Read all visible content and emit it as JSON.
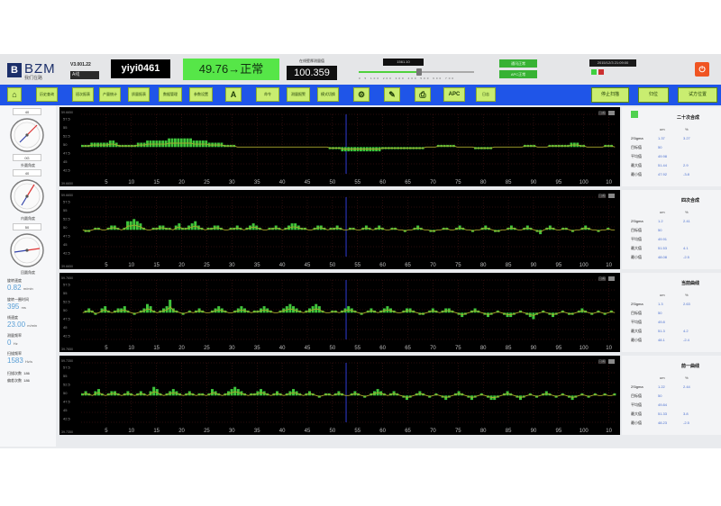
{
  "header": {
    "logo": "BZM",
    "logo_sub": "我们在路",
    "version": "V3.001.22",
    "selector": "A线",
    "user_id": "yiyi0461",
    "status": "49.76→正常",
    "value_caption": "在线壁厚测量值",
    "value": "100.359",
    "range_box": "1561.10",
    "slider_scale": "0 5 100 200 300 400 500 600 700",
    "status_btn_1": "通讯正常",
    "status_btn_2": "APC正常",
    "datetime": "2015/12/3 21:09:00",
    "slider_percent": 52
  },
  "toolbar": {
    "buttons": [
      "历史查询",
      "班次报表",
      "产量统计",
      "质量报表",
      "数据管理",
      "参数设置",
      "A",
      "命令",
      "测量报警",
      "模式切换",
      "⚙",
      "✎",
      "⎙",
      "APC",
      "日志"
    ],
    "stop_scan": "停止扫描",
    "reset": "归位",
    "settings": "试方位置"
  },
  "left_panel": {
    "g1_top": "40",
    "g1_bottom": "0G",
    "g1_label": "外圆角度",
    "g2_top": "40",
    "g2_label": "内圆角度",
    "g3_top": "50",
    "g3_label": "回圆角度",
    "r1_label": "旋转速度",
    "r1_val": "0.82",
    "r1_unit": "m/min",
    "r2_label": "旋转一圈时间",
    "r2_val": "395",
    "r2_unit": "ms",
    "r3_label": "线速度",
    "r3_val": "23.00",
    "r3_unit": "m/min",
    "r4_label": "测量频率",
    "r4_val": "0",
    "r4_unit": "Hz",
    "r5_label": "扫描频率",
    "r5_val": "1583",
    "r5_unit": "Hz/s",
    "r6_label": "扫描次数",
    "r6_val": "186",
    "r7_label": "偏差次数",
    "r7_val": "186"
  },
  "charts": {
    "ticks": [
      "5",
      "10",
      "15",
      "20",
      "25",
      "30",
      "35",
      "40",
      "45",
      "50",
      "55",
      "60",
      "65",
      "70",
      "75",
      "80",
      "85",
      "90",
      "95",
      "100",
      "10"
    ],
    "btn_label": "回图",
    "c1": {
      "title": "二十次合成",
      "y_top": "59.6650",
      "y_bot": "39.6650",
      "ytick": [
        "57.5",
        "55",
        "52.5",
        "50",
        "47.5",
        "45",
        "42.5"
      ],
      "bars": [
        1,
        1,
        1,
        2,
        2,
        2,
        2,
        2,
        2,
        3,
        3,
        2,
        1,
        1,
        1,
        1,
        1,
        1,
        2,
        2,
        2,
        3,
        3,
        3,
        3,
        3,
        3,
        3,
        4,
        4,
        4,
        4,
        4,
        4,
        4,
        4,
        3,
        3,
        3,
        3,
        3,
        2,
        2,
        2,
        2,
        2,
        1,
        1,
        1,
        1,
        0,
        0,
        0,
        0,
        0,
        0,
        0,
        0,
        0,
        0,
        0,
        0,
        0,
        0,
        0,
        0,
        0,
        0,
        0,
        0,
        0,
        0,
        0,
        0,
        0,
        0,
        0,
        0,
        0,
        0,
        -1,
        -1,
        -1,
        -1,
        -2,
        -2,
        -2,
        -2,
        -2,
        -2,
        -2,
        -2,
        -2,
        -2,
        -2,
        -2,
        -2,
        -1,
        -1,
        -1,
        -1,
        -1,
        -1,
        -1,
        -1,
        -1,
        -1,
        -1,
        -1,
        -1,
        -1,
        0,
        0,
        0,
        0,
        1,
        1,
        1,
        1,
        1,
        1,
        0,
        0,
        0,
        0,
        0,
        0,
        -1,
        -1,
        -1,
        -1,
        -1,
        -1,
        0,
        0,
        0,
        0,
        0,
        0,
        0,
        0,
        0,
        0,
        1,
        1,
        1,
        1,
        0,
        0,
        0,
        0,
        1,
        1,
        1,
        1,
        1,
        1,
        1,
        2,
        2,
        2,
        1,
        1,
        0,
        0,
        0,
        0,
        0,
        0,
        1,
        1,
        1,
        0
      ]
    },
    "c2": {
      "title": "四次合成",
      "y_top": "59.6650",
      "y_bot": "39.6650",
      "ytick": [
        "57.5",
        "55",
        "52.5",
        "50",
        "47.5",
        "45",
        "42.5"
      ],
      "bars": [
        0,
        -1,
        -1,
        0,
        1,
        1,
        0,
        0,
        1,
        2,
        2,
        1,
        0,
        1,
        4,
        4,
        5,
        4,
        3,
        1,
        0,
        0,
        1,
        1,
        2,
        2,
        1,
        1,
        0,
        2,
        3,
        1,
        1,
        2,
        3,
        4,
        2,
        1,
        0,
        1,
        1,
        2,
        2,
        1,
        0,
        0,
        1,
        1,
        2,
        1,
        0,
        1,
        2,
        3,
        2,
        1,
        0,
        0,
        1,
        1,
        2,
        1,
        0,
        1,
        2,
        3,
        3,
        2,
        1,
        1,
        0,
        0,
        1,
        2,
        2,
        1,
        0,
        1,
        1,
        2,
        1,
        0,
        0,
        1,
        1,
        0,
        0,
        1,
        2,
        1,
        0,
        1,
        2,
        1,
        0,
        0,
        1,
        1,
        0,
        0,
        -1,
        0,
        0,
        1,
        2,
        1,
        0,
        0,
        -1,
        -1,
        0,
        0,
        1,
        1,
        0,
        0,
        1,
        2,
        1,
        0,
        0,
        -1,
        0,
        0,
        1,
        2,
        1,
        0,
        -1,
        -1,
        0,
        0,
        1,
        2,
        1,
        0,
        0,
        1,
        2,
        1,
        0,
        -1,
        -2,
        0,
        1,
        2,
        1,
        0,
        0,
        1,
        1,
        0,
        -1,
        0,
        0,
        1,
        2,
        1,
        0,
        0,
        -1,
        0,
        0,
        1,
        0,
        0
      ]
    },
    "c3": {
      "title": "当前曲线",
      "y_top": "59.7650",
      "y_bot": "39.7650",
      "ytick": [
        "57.5",
        "55",
        "52.5",
        "50",
        "47.5",
        "45",
        "42.5"
      ],
      "bars": [
        0,
        1,
        2,
        1,
        -1,
        0,
        2,
        3,
        1,
        0,
        1,
        2,
        2,
        3,
        1,
        0,
        -1,
        0,
        1,
        2,
        4,
        3,
        1,
        0,
        1,
        2,
        3,
        6,
        2,
        1,
        0,
        -1,
        0,
        1,
        0,
        1,
        2,
        1,
        0,
        0,
        1,
        2,
        3,
        2,
        1,
        0,
        0,
        1,
        2,
        3,
        2,
        1,
        0,
        1,
        1,
        2,
        3,
        2,
        1,
        0,
        0,
        1,
        2,
        3,
        4,
        3,
        2,
        1,
        0,
        1,
        2,
        3,
        4,
        3,
        1,
        0,
        0,
        1,
        1,
        0,
        1,
        2,
        3,
        2,
        1,
        0,
        -1,
        0,
        1,
        2,
        1,
        0,
        1,
        2,
        3,
        2,
        1,
        0,
        0,
        1,
        2,
        2,
        1,
        0,
        -1,
        -1,
        0,
        1,
        2,
        1,
        0,
        1,
        2,
        2,
        1,
        0,
        -1,
        -2,
        -1,
        0,
        1,
        2,
        1,
        0,
        -1,
        -2,
        -1,
        0,
        1,
        0,
        -1,
        -2,
        -2,
        -1,
        0,
        1,
        0,
        -1,
        -2,
        -3,
        -1,
        0,
        1,
        0,
        -1,
        -2,
        -1,
        0,
        1,
        0,
        -1,
        -1,
        0,
        1,
        2,
        1,
        0,
        -1,
        0,
        1,
        0,
        -1,
        0,
        1,
        0
      ]
    },
    "c4": {
      "title": "前一曲线",
      "y_top": "59.7350",
      "y_bot": "39.7350",
      "ytick": [
        "57.5",
        "55",
        "52.5",
        "50",
        "47.5",
        "45",
        "42.5"
      ],
      "bars": [
        1,
        2,
        1,
        0,
        2,
        3,
        1,
        0,
        1,
        2,
        2,
        1,
        0,
        1,
        2,
        1,
        0,
        1,
        2,
        1,
        0,
        2,
        4,
        3,
        1,
        0,
        1,
        2,
        3,
        2,
        1,
        0,
        1,
        2,
        1,
        0,
        1,
        1,
        0,
        1,
        3,
        2,
        1,
        0,
        1,
        2,
        3,
        4,
        3,
        2,
        1,
        0,
        1,
        1,
        2,
        3,
        2,
        1,
        0,
        1,
        2,
        1,
        0,
        1,
        2,
        3,
        2,
        1,
        0,
        1,
        2,
        1,
        0,
        -1,
        0,
        1,
        1,
        0,
        1,
        2,
        1,
        0,
        0,
        1,
        2,
        1,
        0,
        -1,
        0,
        1,
        2,
        3,
        2,
        1,
        0,
        1,
        2,
        1,
        0,
        -1,
        -2,
        -1,
        0,
        1,
        2,
        1,
        0,
        -1,
        0,
        1,
        0,
        -1,
        -2,
        -1,
        0,
        1,
        2,
        1,
        0,
        -1,
        -2,
        -1,
        0,
        1,
        0,
        -1,
        -2,
        -2,
        -1,
        0,
        1,
        2,
        1,
        0,
        -1,
        -2,
        -1,
        0,
        1,
        0,
        -1,
        0,
        1,
        2,
        1,
        0,
        -1,
        0,
        1,
        0,
        -1,
        -2,
        -1,
        0,
        1,
        0,
        -1,
        0,
        1,
        0,
        0,
        1,
        0,
        0,
        1
      ]
    }
  },
  "stats": {
    "head_um": "um",
    "head_pct": "%",
    "row_labels": [
      "2Sigma",
      "目标值",
      "平均值",
      "最大值",
      "最小值"
    ],
    "s1": {
      "c1": [
        "1.37",
        "50",
        "49.98",
        "51.44",
        "47.92"
      ],
      "c2": [
        "3.27",
        "",
        "",
        "2.9",
        "-3.8"
      ]
    },
    "s2": {
      "c1": [
        "1.2",
        "50",
        "49.91",
        "51.53",
        "48.08"
      ],
      "c2": [
        "2.41",
        "",
        "",
        "4.1",
        "-2.5"
      ]
    },
    "s3": {
      "c1": [
        "1.3",
        "50",
        "49.8",
        "51.3",
        "48.1"
      ],
      "c2": [
        "2.63",
        "",
        "",
        "4.2",
        "-2.4"
      ]
    },
    "s4": {
      "c1": [
        "1.22",
        "50",
        "49.84",
        "51.33",
        "48.23"
      ],
      "c2": [
        "2.44",
        "",
        "",
        "3.8",
        "-2.5"
      ]
    }
  },
  "colors": {
    "toolbar": "#1f55e8",
    "status_green": "#56e648",
    "bar": "#3fc53b",
    "trace": "#a9a72c",
    "grid": "#6b2020",
    "cursor": "#2e3bd4"
  }
}
